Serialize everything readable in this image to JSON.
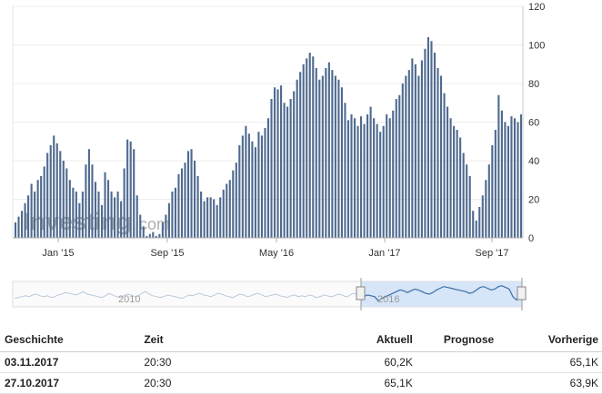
{
  "chart_data": {
    "type": "bar",
    "color": "#4f6a8f",
    "ylim": [
      0,
      120
    ],
    "y_ticks": [
      0,
      20,
      40,
      60,
      80,
      100,
      120
    ],
    "x_tick_labels": [
      "Jan '15",
      "Sep '15",
      "May '16",
      "Jan '17",
      "Sep '17"
    ],
    "values": [
      8,
      11,
      14,
      18,
      22,
      28,
      24,
      30,
      32,
      37,
      44,
      48,
      53,
      49,
      45,
      40,
      36,
      30,
      26,
      24,
      18,
      24,
      38,
      46,
      38,
      29,
      24,
      17,
      34,
      30,
      24,
      21,
      24,
      19,
      36,
      51,
      50,
      46,
      22,
      12,
      6,
      1,
      2,
      3,
      1,
      2,
      8,
      12,
      18,
      24,
      26,
      33,
      36,
      39,
      45,
      46,
      40,
      32,
      24,
      19,
      21,
      21,
      20,
      17,
      21,
      25,
      28,
      30,
      35,
      39,
      48,
      53,
      58,
      54,
      50,
      47,
      55,
      53,
      57,
      62,
      72,
      78,
      77,
      79,
      70,
      68,
      72,
      76,
      82,
      86,
      90,
      93,
      96,
      94,
      88,
      82,
      84,
      88,
      91,
      87,
      84,
      82,
      78,
      70,
      61,
      64,
      62,
      58,
      63,
      59,
      64,
      68,
      62,
      59,
      55,
      58,
      64,
      62,
      66,
      72,
      74,
      80,
      84,
      87,
      93,
      90,
      84,
      92,
      98,
      104,
      102,
      96,
      88,
      84,
      75,
      68,
      62,
      58,
      56,
      52,
      44,
      38,
      32,
      14,
      9,
      16,
      22,
      30,
      38,
      48,
      56,
      74,
      66,
      60,
      58,
      63,
      62,
      60,
      64
    ]
  },
  "watermark": {
    "brand": "Investing",
    "suffix": ".com"
  },
  "navigator": {
    "labels": [
      "2010",
      "2016"
    ],
    "series": [
      38,
      39,
      40,
      41,
      40,
      42,
      43,
      41,
      40,
      41,
      39,
      40,
      42,
      43,
      45,
      44,
      43,
      42,
      44,
      46,
      43,
      42,
      41,
      40,
      39,
      41,
      44,
      42,
      40,
      39,
      41,
      43,
      42,
      40,
      41,
      44,
      46,
      43,
      41,
      40,
      39,
      40,
      42,
      41,
      40,
      39,
      38,
      40,
      42,
      41,
      43,
      44,
      42,
      41,
      40,
      42,
      44,
      43,
      41,
      40,
      39,
      41,
      43,
      42,
      40,
      41,
      43,
      44,
      42,
      40,
      41,
      42,
      43,
      41,
      40,
      39,
      41,
      42,
      40,
      41,
      40,
      42,
      41,
      39,
      40,
      42,
      41,
      40,
      41,
      43,
      42,
      40,
      41,
      44,
      43,
      41,
      40,
      42,
      41,
      40,
      35,
      38,
      40,
      42,
      44,
      46,
      48,
      47,
      45,
      47,
      49,
      48,
      46,
      44,
      43,
      45,
      48,
      50,
      52,
      51,
      50,
      49,
      48,
      47,
      46,
      44,
      45,
      48,
      51,
      52,
      50,
      48,
      49,
      52,
      53,
      51,
      49,
      40,
      36,
      45
    ]
  },
  "table": {
    "headers": {
      "date": "Geschichte",
      "time": "Zeit",
      "actual": "Aktuell",
      "forecast": "Prognose",
      "previous": "Vorherige"
    },
    "rows": [
      {
        "date": "03.11.2017",
        "time": "20:30",
        "actual": "60,2K",
        "forecast": "",
        "previous": "65,1K"
      },
      {
        "date": "27.10.2017",
        "time": "20:30",
        "actual": "65,1K",
        "forecast": "",
        "previous": "63,9K"
      }
    ]
  }
}
